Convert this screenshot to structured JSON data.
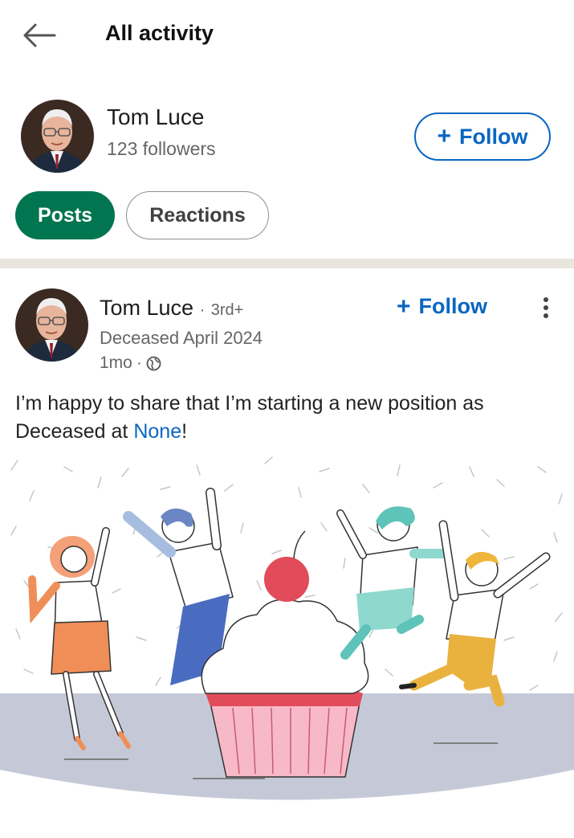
{
  "header": {
    "title": "All activity",
    "back_icon": "arrow-left-icon"
  },
  "profile": {
    "name": "Tom Luce",
    "followers": "123 followers",
    "follow_label": "Follow"
  },
  "tabs": [
    {
      "label": "Posts",
      "active": true
    },
    {
      "label": "Reactions",
      "active": false
    }
  ],
  "post": {
    "author": "Tom Luce",
    "separator": "·",
    "degree": "3rd+",
    "headline": "Deceased April 2024",
    "time": "1mo",
    "time_separator": "·",
    "visibility_icon": "globe-icon",
    "follow_label": "Follow",
    "text_before": "I’m happy to share that I’m starting a new position as Deceased at ",
    "link": "None",
    "text_after": "!"
  },
  "colors": {
    "brand_blue": "#0a66c2",
    "active_tab_green": "#01754f",
    "divider": "#e9e5df"
  }
}
